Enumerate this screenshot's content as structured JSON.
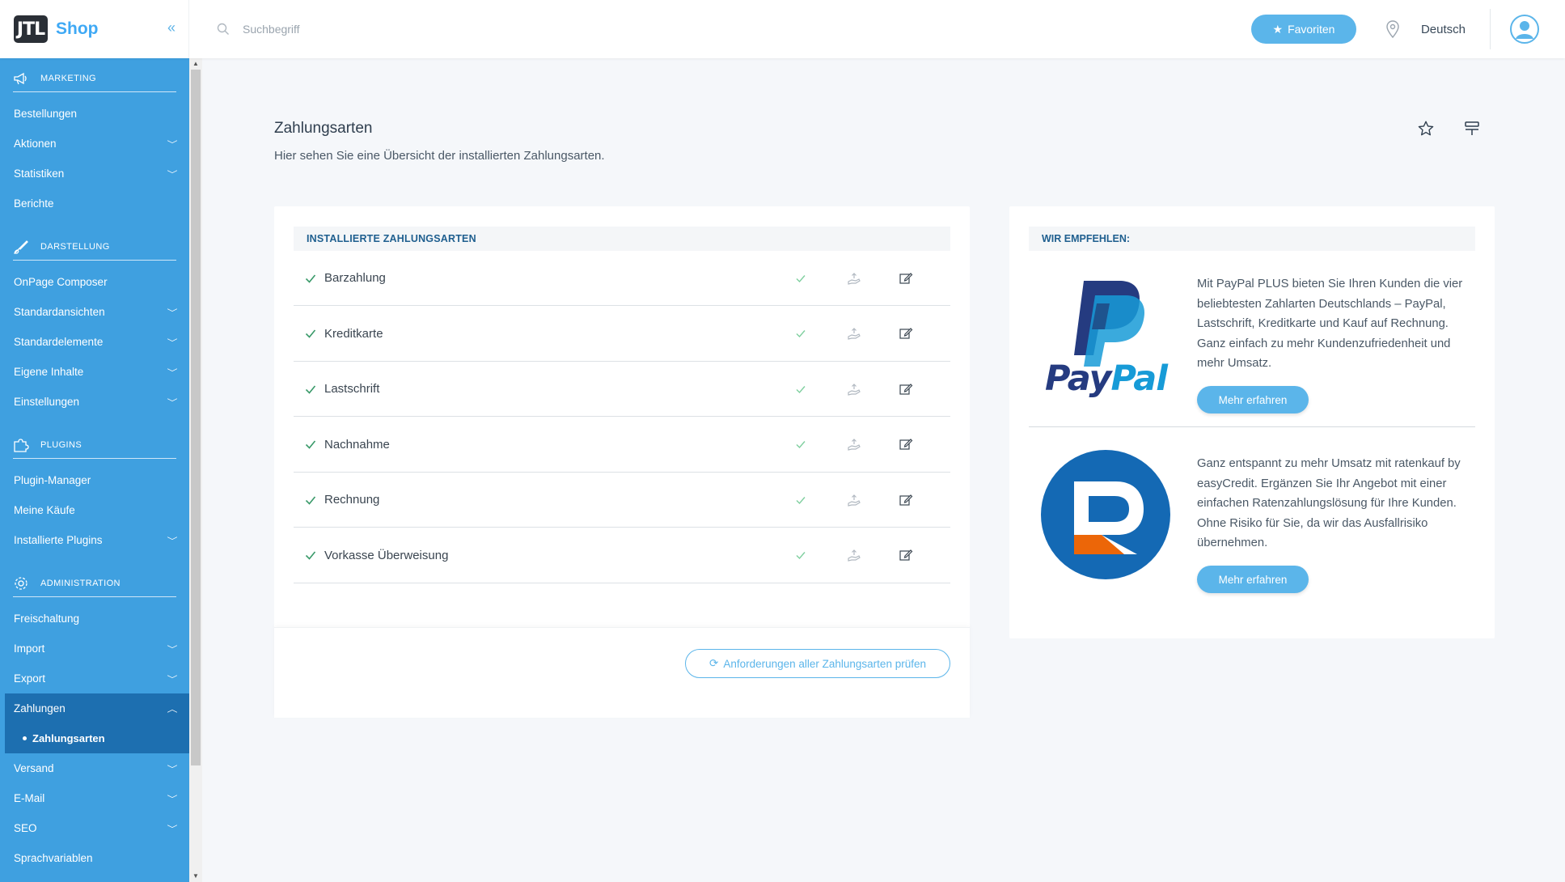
{
  "brand": {
    "logo": "JTL",
    "name": "Shop",
    "collapse": "«"
  },
  "header": {
    "search_placeholder": "Suchbegriff",
    "favorites_label": "Favoriten",
    "language": "Deutsch"
  },
  "sidebar": {
    "sections": [
      {
        "title": "MARKETING",
        "items": [
          {
            "label": "Bestellungen",
            "chevron": false
          },
          {
            "label": "Aktionen",
            "chevron": true
          },
          {
            "label": "Statistiken",
            "chevron": true
          },
          {
            "label": "Berichte",
            "chevron": false
          }
        ]
      },
      {
        "title": "DARSTELLUNG",
        "items": [
          {
            "label": "OnPage Composer",
            "chevron": false
          },
          {
            "label": "Standardansichten",
            "chevron": true
          },
          {
            "label": "Standardelemente",
            "chevron": true
          },
          {
            "label": "Eigene Inhalte",
            "chevron": true
          },
          {
            "label": "Einstellungen",
            "chevron": true
          }
        ]
      },
      {
        "title": "PLUGINS",
        "items": [
          {
            "label": "Plugin-Manager",
            "chevron": false
          },
          {
            "label": "Meine Käufe",
            "chevron": false
          },
          {
            "label": "Installierte Plugins",
            "chevron": true
          }
        ]
      },
      {
        "title": "ADMINISTRATION",
        "items": [
          {
            "label": "Freischaltung",
            "chevron": false
          },
          {
            "label": "Import",
            "chevron": true
          },
          {
            "label": "Export",
            "chevron": true
          },
          {
            "label": "Zahlungen",
            "chevron": true,
            "active": true
          },
          {
            "label": "Versand",
            "chevron": true
          },
          {
            "label": "E-Mail",
            "chevron": true
          },
          {
            "label": "SEO",
            "chevron": true
          },
          {
            "label": "Sprachvariablen",
            "chevron": false
          }
        ]
      }
    ],
    "active_sub": "Zahlungsarten"
  },
  "page": {
    "title": "Zahlungsarten",
    "description": "Hier sehen Sie eine Übersicht der installierten Zahlungsarten."
  },
  "installed": {
    "heading": "INSTALLIERTE ZAHLUNGSARTEN",
    "methods": [
      "Barzahlung",
      "Kreditkarte",
      "Lastschrift",
      "Nachnahme",
      "Rechnung",
      "Vorkasse Überweisung"
    ],
    "check_all_label": "Anforderungen aller Zahlungsarten prüfen"
  },
  "recommend": {
    "heading": "WIR EMPFEHLEN:",
    "paypal": {
      "logo_text_1": "Pay",
      "logo_text_2": "Pal",
      "text": "Mit PayPal PLUS bieten Sie Ihren Kunden die vier beliebtesten Zahlarten Deutschlands – PayPal, Lastschrift, Kreditkarte und Kauf auf Rechnung. Ganz einfach zu mehr Kundenzufriedenheit und mehr Umsatz.",
      "button": "Mehr erfahren"
    },
    "easycredit": {
      "text": "Ganz entspannt zu mehr Umsatz mit ratenkauf by easyCredit. Ergänzen Sie Ihr Angebot mit einer einfachen Ratenzahlungslösung für Ihre Kunden. Ohne Risiko für Sie, da wir das Ausfallrisiko übernehmen.",
      "button": "Mehr erfahren"
    }
  },
  "colors": {
    "accent": "#5bb5ea",
    "sidebar": "#3fa0e0",
    "sidebar_active": "#1d6fb0",
    "heading": "#1f5f8f",
    "check": "#3a9a6a"
  }
}
